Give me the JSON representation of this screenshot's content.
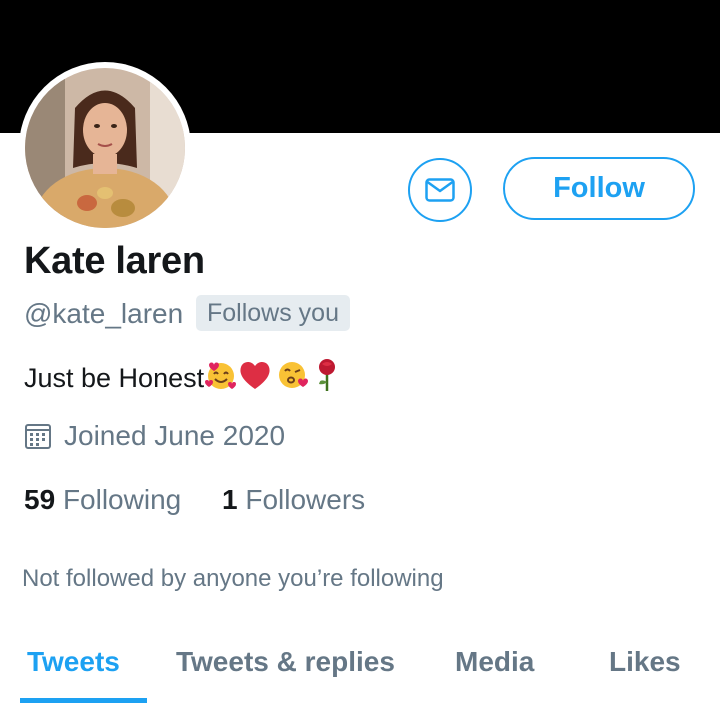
{
  "profile": {
    "name": "Kate laren",
    "handle": "@kate_laren",
    "follows_you_badge": "Follows you",
    "bio": "Just be Honest",
    "bio_emojis": [
      "smiling-face-with-hearts",
      "red-heart",
      "face-blowing-kiss",
      "rose"
    ],
    "joined": "Joined June 2020",
    "following_count": "59",
    "following_label": "Following",
    "followers_count": "1",
    "followers_label": "Followers",
    "followed_by_note": "Not followed by anyone you’re following"
  },
  "actions": {
    "message_icon": "envelope-icon",
    "follow_label": "Follow"
  },
  "tabs": [
    {
      "label": "Tweets",
      "active": true
    },
    {
      "label": "Tweets & replies",
      "active": false
    },
    {
      "label": "Media",
      "active": false
    },
    {
      "label": "Likes",
      "active": false
    }
  ],
  "colors": {
    "accent": "#1da1f2",
    "secondary_text": "#657786",
    "banner": "#000000",
    "badge_bg": "#e6ecf0"
  }
}
